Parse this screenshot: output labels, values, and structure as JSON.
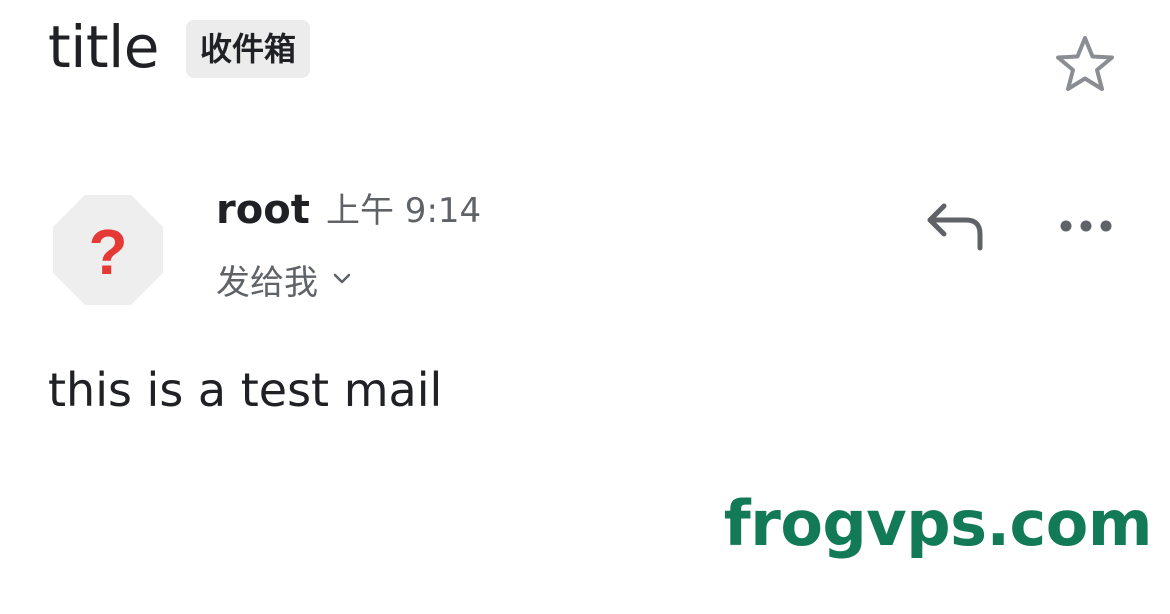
{
  "email": {
    "subject": "title",
    "label": "收件箱",
    "sender_name": "root",
    "time": "上午 9:14",
    "recipient": "发给我",
    "body": "this is a test mail"
  },
  "icons": {
    "star": "star-outline-icon",
    "reply": "reply-icon",
    "more": "more-horizontal-icon",
    "avatar": "unknown-sender-icon",
    "chevron": "chevron-down-icon"
  },
  "colors": {
    "avatar_bg": "#eeeeee",
    "avatar_mark": "#e53935",
    "watermark": "#127a56",
    "icon_gray": "#5f6368"
  },
  "watermark": {
    "text": "frogvps.com"
  }
}
